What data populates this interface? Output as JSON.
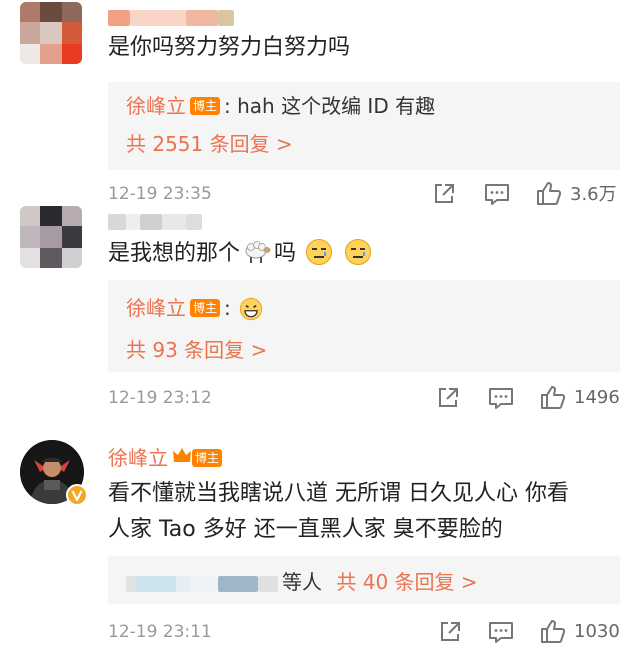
{
  "comments": [
    {
      "body": "是你吗努力努力白努力吗",
      "reply": {
        "author": "徐峰立",
        "badge": "博主",
        "text": ": hah 这个改编 ID 有趣"
      },
      "more": "共 2551 条回复 >",
      "time": "12-19 23:35",
      "likes": "3.6万"
    },
    {
      "body_prefix": "是我想的那个",
      "body_suffix": "吗",
      "reply": {
        "author": "徐峰立",
        "badge": "博主",
        "text": ":"
      },
      "more": "共 93 条回复 >",
      "time": "12-19 23:12",
      "likes": "1496"
    },
    {
      "author": "徐峰立",
      "badge": "博主",
      "body_line1": "看不懂就当我瞎说八道 无所谓 日久见人心 你看",
      "body_line2": "人家 Tao 多好 还一直黑人家 臭不要脸的",
      "reply_suffix": "等人",
      "more": "共 40 条回复 >",
      "time": "12-19 23:11",
      "likes": "1030"
    }
  ],
  "icons": {
    "share": "share-icon",
    "comment": "comment-icon",
    "like": "like-icon",
    "sheep": "sheep-emoji-icon",
    "smirk": "smirk-emoji-icon",
    "grin": "grin-emoji-icon",
    "verified": "verified-badge-icon",
    "crown": "crown-icon"
  },
  "colors": {
    "accent": "#eb7350",
    "badge": "#ff8200",
    "meta": "#999999",
    "reply_bg": "#f5f5f5"
  }
}
